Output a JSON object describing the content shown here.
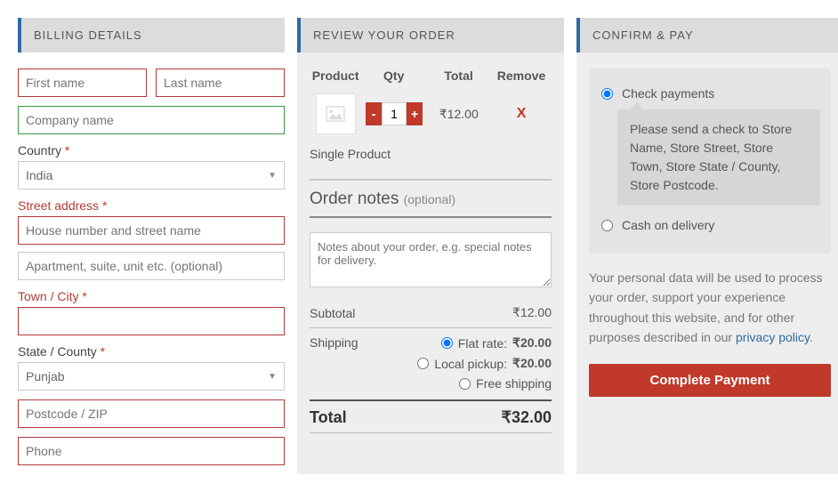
{
  "billing": {
    "title": "BILLING DETAILS",
    "first_name_ph": "First name",
    "last_name_ph": "Last name",
    "company_ph": "Company name",
    "country_label": "Country",
    "country_value": "India",
    "street_label": "Street address",
    "street1_ph": "House number and street name",
    "street2_ph": "Apartment, suite, unit etc. (optional)",
    "town_label": "Town / City",
    "state_label": "State / County",
    "state_value": "Punjab",
    "postcode_ph": "Postcode / ZIP",
    "phone_ph": "Phone",
    "required_mark": "*"
  },
  "review": {
    "title": "REVIEW YOUR ORDER",
    "col_product": "Product",
    "col_qty": "Qty",
    "col_total": "Total",
    "col_remove": "Remove",
    "qty_value": "1",
    "line_total": "₹12.00",
    "remove_x": "X",
    "product_name": "Single Product",
    "notes_title": "Order notes",
    "notes_optional": "(optional)",
    "notes_ph": "Notes about your order, e.g. special notes for delivery.",
    "subtotal_label": "Subtotal",
    "subtotal_value": "₹12.00",
    "shipping_label": "Shipping",
    "ship_flat": "Flat rate:",
    "ship_flat_price": "₹20.00",
    "ship_local": "Local pickup:",
    "ship_local_price": "₹20.00",
    "ship_free": "Free shipping",
    "total_label": "Total",
    "total_value": "₹32.00"
  },
  "pay": {
    "title": "CONFIRM & PAY",
    "check_label": "Check payments",
    "check_desc": "Please send a check to Store Name, Store Street, Store Town, Store State / County, Store Postcode.",
    "cod_label": "Cash on delivery",
    "privacy_text": "Your personal data will be used to process your order, support your experience throughout this website, and for other purposes described in our ",
    "privacy_link": "privacy policy",
    "privacy_dot": ".",
    "button": "Complete Payment"
  }
}
